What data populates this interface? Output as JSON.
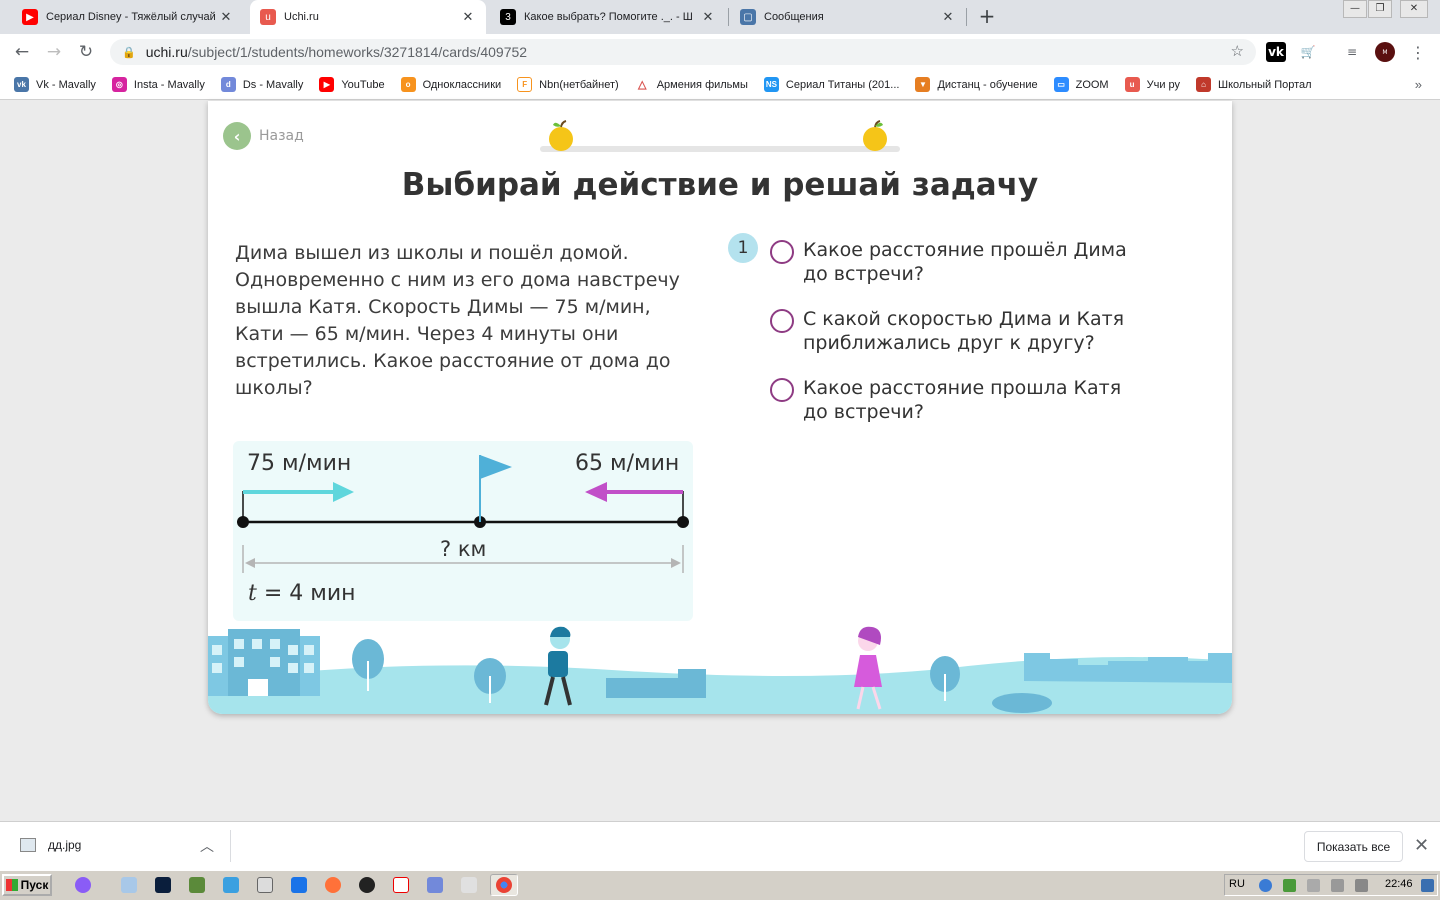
{
  "browser": {
    "tabs": [
      {
        "title": "Сериал Disney - Тяжёлый случай (",
        "favicon": "youtube-icon",
        "color": "#ff0000"
      },
      {
        "title": "Uchi.ru",
        "favicon": "uchi-icon",
        "color": "#e85a4f"
      },
      {
        "title": "Какое выбрать? Помогите ._. - Ш",
        "favicon": "znanija-icon",
        "color": "#000000"
      },
      {
        "title": "Сообщения",
        "favicon": "vk-messages-icon",
        "color": "#4a76a8"
      }
    ],
    "url_host": "uchi.ru",
    "url_path": "/subject/1/students/homeworks/3271814/cards/409752",
    "bookmarks": [
      {
        "label": "Vk - Mavally",
        "icon": "vk-icon",
        "color": "#4a76a8"
      },
      {
        "label": "Insta - Mavally",
        "icon": "instagram-icon",
        "color": "#d6249f"
      },
      {
        "label": "Ds - Mavally",
        "icon": "discord-icon",
        "color": "#7289da"
      },
      {
        "label": "YouTube",
        "icon": "youtube-icon",
        "color": "#ff0000"
      },
      {
        "label": "Одноклассники",
        "icon": "ok-icon",
        "color": "#f7931e"
      },
      {
        "label": "Nbn(нетбайнет)",
        "icon": "nbn-icon",
        "color": "#f7931e"
      },
      {
        "label": "Армения фильмы",
        "icon": "armenia-icon",
        "color": "#d9534f"
      },
      {
        "label": "Сериал Титаны (201...",
        "icon": "ns-icon",
        "color": "#2196f3"
      },
      {
        "label": "Дистанц - обучение",
        "icon": "fox-icon",
        "color": "#e67e22"
      },
      {
        "label": "ZOOM",
        "icon": "zoom-icon",
        "color": "#2d8cff"
      },
      {
        "label": "Учи ру",
        "icon": "uchi-icon",
        "color": "#e85a4f"
      },
      {
        "label": "Школьный Портал",
        "icon": "portal-icon",
        "color": "#c0392b"
      }
    ]
  },
  "page": {
    "back_label": "Назад",
    "title": "Выбирай действие и решай задачу",
    "problem": "Дима вышел из школы и пошёл домой. Одновременно с ним из его дома навстречу вышла Катя. Скорость Димы — 75 м/мин, Кати — 65 м/мин. Через 4 минуты они встретились. Какое расстояние от дома до школы?",
    "scheme": {
      "speed_left": "75 м/мин",
      "speed_right": "65 м/мин",
      "distance": "? км",
      "time_var": "t",
      "time_rest": " = 4 мин"
    },
    "step_number": "1",
    "options": [
      "Какое расстояние прошёл Дима до встречи?",
      "С какой скоростью Дима и Катя приближались друг к другу?",
      "Какое расстояние прошла Катя до встречи?"
    ]
  },
  "downloads": {
    "file": "дд.jpg",
    "show_all": "Показать все"
  },
  "taskbar": {
    "start": "Пуск",
    "lang": "RU",
    "time": "22:46"
  }
}
